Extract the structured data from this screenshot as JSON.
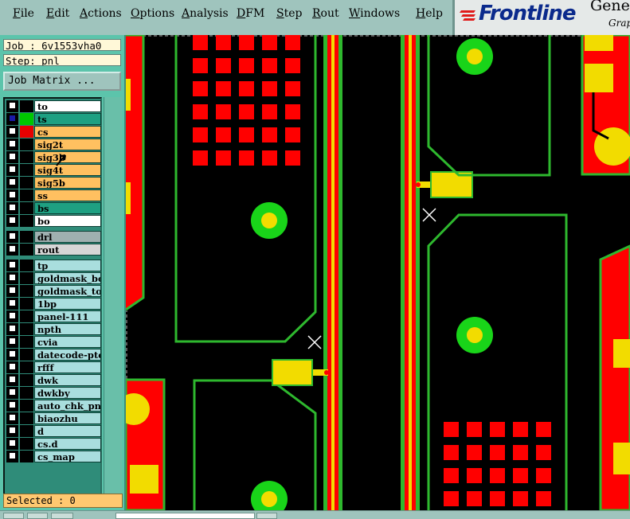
{
  "menu": {
    "items": [
      "File",
      "Edit",
      "Actions",
      "Options",
      "Analysis",
      "DFM",
      "Step",
      "Rout",
      "Windows",
      "Help"
    ]
  },
  "brand": {
    "logo": "Frontline",
    "title_fragment": "Gene",
    "subtitle_fragment": "Grap"
  },
  "job": {
    "label": "Job : 6v1553vha0"
  },
  "step": {
    "label": "Step: pnl"
  },
  "job_matrix_button": "Job Matrix ...",
  "layers": [
    {
      "name": "to",
      "color": "#ffffff",
      "swatch": "#000000"
    },
    {
      "name": "ts",
      "color": "#1ea082",
      "swatch": "#00c800",
      "selected": true
    },
    {
      "name": "cs",
      "color": "#ffc060",
      "swatch": "#e60000"
    },
    {
      "name": "sig2t",
      "color": "#ffc060",
      "swatch": "#000000"
    },
    {
      "name": "sig3b",
      "color": "#ffc060",
      "swatch": "#000000"
    },
    {
      "name": "sig4t",
      "color": "#ffc060",
      "swatch": "#000000"
    },
    {
      "name": "sig5b",
      "color": "#ffc060",
      "swatch": "#000000"
    },
    {
      "name": "ss",
      "color": "#ffc060",
      "swatch": "#000000"
    },
    {
      "name": "bs",
      "color": "#1ea082",
      "swatch": "#000000"
    },
    {
      "name": "bo",
      "color": "#ffffff",
      "swatch": "#000000"
    },
    {
      "name": "drl",
      "color": "#9fb0b0",
      "swatch": "#000000"
    },
    {
      "name": "rout",
      "color": "#d6d6d6",
      "swatch": "#000000"
    },
    {
      "name": "tp",
      "color": "#a9dede",
      "swatch": "#000000"
    },
    {
      "name": "goldmask_bot",
      "color": "#a9dede",
      "swatch": "#000000"
    },
    {
      "name": "goldmask_top",
      "color": "#a9dede",
      "swatch": "#000000"
    },
    {
      "name": "1bp",
      "color": "#a9dede",
      "swatch": "#000000"
    },
    {
      "name": "panel-111",
      "color": "#a9dede",
      "swatch": "#000000"
    },
    {
      "name": "npth",
      "color": "#a9dede",
      "swatch": "#000000"
    },
    {
      "name": "cvia",
      "color": "#a9dede",
      "swatch": "#000000"
    },
    {
      "name": "datecode-pto",
      "color": "#a9dede",
      "swatch": "#000000"
    },
    {
      "name": "rfff",
      "color": "#a9dede",
      "swatch": "#000000"
    },
    {
      "name": "dwk",
      "color": "#a9dede",
      "swatch": "#000000"
    },
    {
      "name": "dwkby",
      "color": "#a9dede",
      "swatch": "#000000"
    },
    {
      "name": "auto_chk_pnl",
      "color": "#a9dede",
      "swatch": "#000000"
    },
    {
      "name": "biaozhu",
      "color": "#a9dede",
      "swatch": "#000000"
    },
    {
      "name": "d",
      "color": "#a9dede",
      "swatch": "#000000"
    },
    {
      "name": "cs.d",
      "color": "#a9dede",
      "swatch": "#000000"
    },
    {
      "name": "cs_map",
      "color": "#a9dede",
      "swatch": "#000000"
    }
  ],
  "selected_label": "Selected : 0",
  "colors": {
    "copper_red": "#ff0000",
    "outline_green": "#2eb82e",
    "pad_yellow": "#f2dc00",
    "via_green": "#19d419",
    "panel_teal": "#5cc4ab"
  }
}
